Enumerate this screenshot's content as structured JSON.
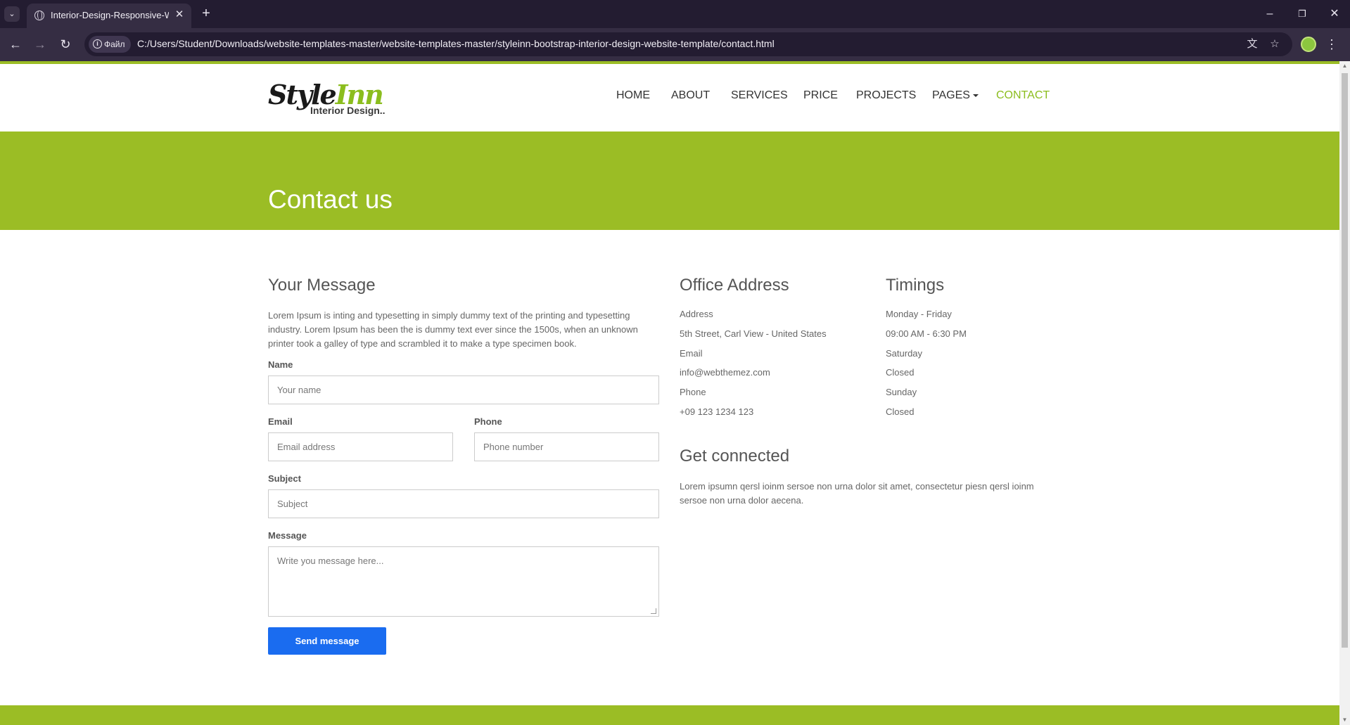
{
  "browser": {
    "tab_title": "Interior-Design-Responsive-Web",
    "tab_menu_icon": "chevron-down-icon",
    "site_chip": "Файл",
    "url": "C:/Users/Student/Downloads/website-templates-master/website-templates-master/styleinn-bootstrap-interior-design-website-template/contact.html"
  },
  "site": {
    "logo_script_black": "Style",
    "logo_script_green": "Inn",
    "logo_sub": "Interior Design..",
    "nav": [
      "HOME",
      "ABOUT",
      "SERVICES",
      "PRICE",
      "PROJECTS",
      "PAGES",
      "CONTACT"
    ],
    "active_nav": "CONTACT",
    "accent_color": "#9bbd25"
  },
  "hero": {
    "title": "Contact us"
  },
  "form": {
    "heading": "Your Message",
    "intro": "Lorem Ipsum is inting and typesetting in simply dummy text of the printing and typesetting industry. Lorem Ipsum has been the is dummy text ever since the 1500s, when an unknown printer took a galley of type and scrambled it to make a type specimen book.",
    "name_label": "Name",
    "name_placeholder": "Your name",
    "email_label": "Email",
    "email_placeholder": "Email address",
    "phone_label": "Phone",
    "phone_placeholder": "Phone number",
    "subject_label": "Subject",
    "subject_placeholder": "Subject",
    "message_label": "Message",
    "message_placeholder": "Write you message here...",
    "submit_label": "Send message",
    "submit_color": "#1a6cf0"
  },
  "office": {
    "heading": "Office Address",
    "lines": [
      "Address",
      "5th Street, Carl View - United States",
      "Email",
      "info@webthemez.com",
      "Phone",
      "+09 123 1234 123"
    ]
  },
  "timings": {
    "heading": "Timings",
    "lines": [
      "Monday - Friday",
      "09:00 AM - 6:30 PM",
      "Saturday",
      "Closed",
      "Sunday",
      "Closed"
    ]
  },
  "connected": {
    "heading": "Get connected",
    "text": "Lorem ipsumn qersl ioinm sersoe non urna dolor sit amet, consectetur piesn qersl ioinm sersoe non urna dolor aecena."
  }
}
